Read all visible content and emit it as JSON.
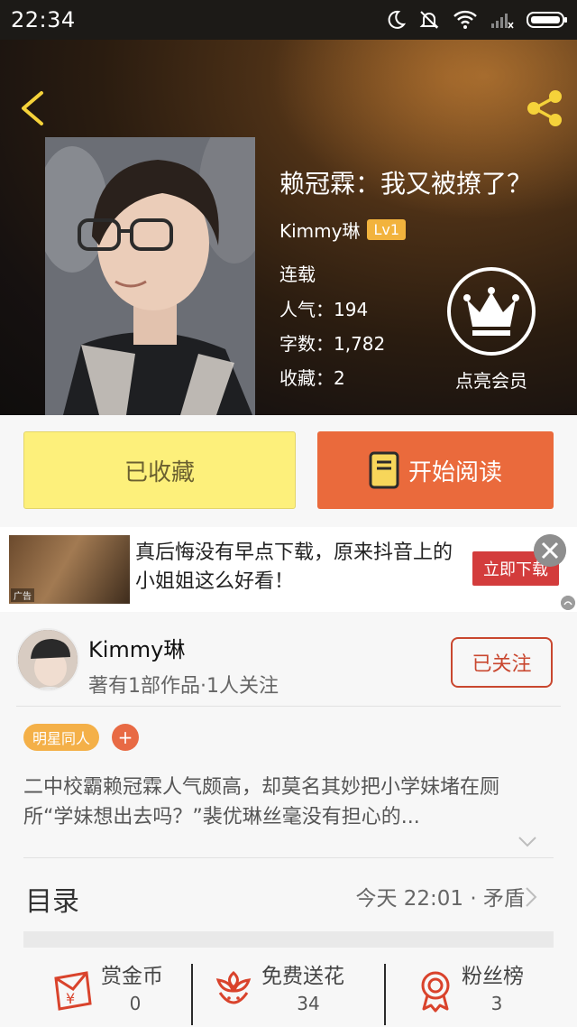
{
  "status_bar": {
    "time": "22:34"
  },
  "book": {
    "title": "赖冠霖：我又被撩了？",
    "author": "Kimmy琳",
    "level": "Lv1",
    "status": "连载",
    "popularity": "人气：194",
    "word_count": "字数：1,782",
    "favorites": "收藏：2"
  },
  "vip": {
    "label": "点亮会员"
  },
  "actions": {
    "favorited_label": "已收藏",
    "read_label": "开始阅读"
  },
  "ad": {
    "thumb_tag": "广告",
    "text": "真后悔没有早点下载，原来抖音上的小姐姐这么好看！",
    "button": "立即下载"
  },
  "author_card": {
    "name": "Kimmy琳",
    "subtitle": "著有1部作品·1人关注",
    "follow_label": "已关注"
  },
  "tags": {
    "genre": "明星同人",
    "add": "+"
  },
  "description": "二中校霸赖冠霖人气颇高，却莫名其妙把小学妹堵在厕所“学妹想出去吗？”裴优琳丝毫没有担心的...",
  "toc": {
    "label": "目录",
    "latest": "今天 22:01 · 矛盾"
  },
  "bottom": {
    "reward": {
      "label": "赏金币",
      "value": "0"
    },
    "flowers": {
      "label": "免费送花",
      "value": "34"
    },
    "fans": {
      "label": "粉丝榜",
      "value": "3"
    }
  },
  "colors": {
    "read_button": "#ea6a3c",
    "favorite_button": "#fdf07b",
    "follow_border": "#c9472f",
    "level_badge": "#f2b33d",
    "genre_tag": "#f4b048",
    "icon_red": "#d9432c"
  }
}
